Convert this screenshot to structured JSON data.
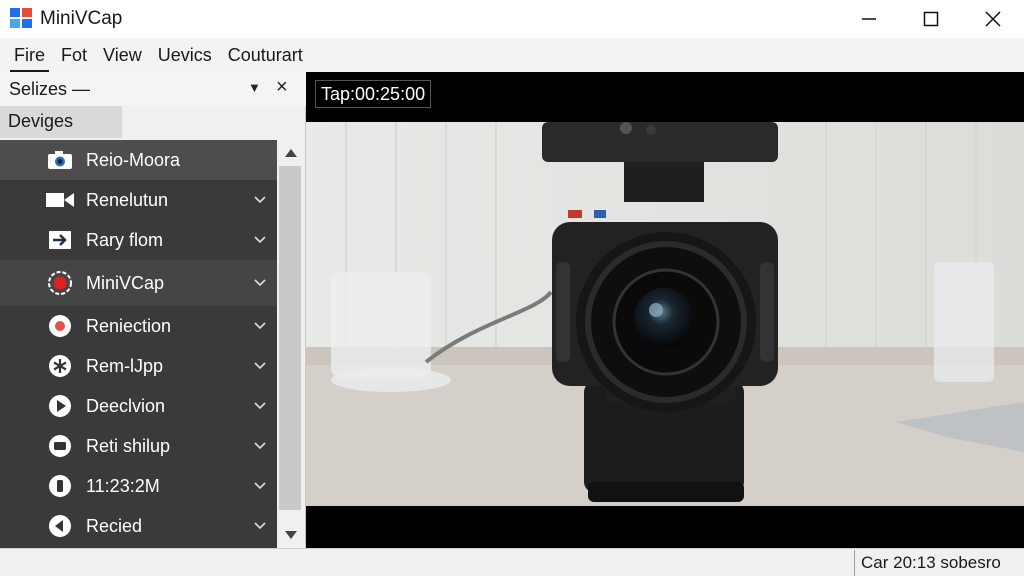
{
  "window": {
    "title": "MiniVCap",
    "icon": "windows-app-icon",
    "controls": [
      "minimize-icon",
      "maximize-icon",
      "close-icon"
    ]
  },
  "menu": {
    "items": [
      "Fire",
      "Fot",
      "View",
      "Uevics",
      "Couturart"
    ]
  },
  "panel": {
    "title": "Selizes —",
    "section": "Deviges",
    "items": [
      {
        "label": "Reio-Moora",
        "icon": "camera-icon",
        "chevron": false
      },
      {
        "label": "Renelutun",
        "icon": "video-camera-icon",
        "chevron": true
      },
      {
        "label": "Rary flom",
        "icon": "arrow-right-icon",
        "chevron": true
      },
      {
        "label": "MiniVCap",
        "icon": "record-icon",
        "chevron": true
      },
      {
        "label": "Reniection",
        "icon": "record-dot-icon",
        "chevron": true
      },
      {
        "label": "Rem-lJpp",
        "icon": "asterisk-icon",
        "chevron": true
      },
      {
        "label": "Deeclvion",
        "icon": "play-icon",
        "chevron": true
      },
      {
        "label": "Reti shilup",
        "icon": "stop-icon",
        "chevron": true
      },
      {
        "label": "11:23:2M",
        "icon": "pause-icon",
        "chevron": true
      },
      {
        "label": "Recied",
        "icon": "back-icon",
        "chevron": true
      }
    ]
  },
  "video": {
    "timer": "Tap:00:25:00"
  },
  "status": {
    "text": "Car 20:13 sobesro"
  },
  "colors": {
    "list_bg": "#3a3a3a",
    "record_red": "#e02020",
    "accent_blue": "#1a73e8"
  }
}
